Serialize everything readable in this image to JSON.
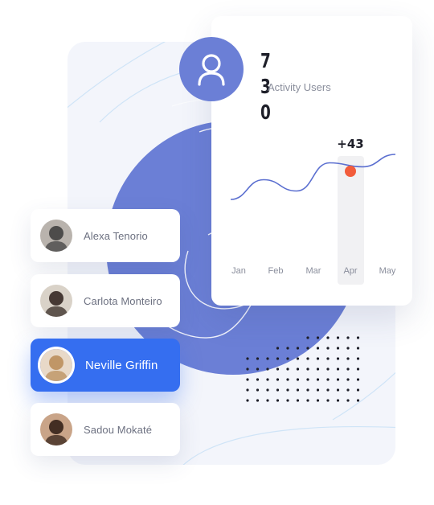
{
  "users": [
    {
      "name": "Alexa Tenorio",
      "active": false
    },
    {
      "name": "Carlota Monteiro",
      "active": false
    },
    {
      "name": "Neville Griffin",
      "active": true
    },
    {
      "name": "Sadou Mokaté",
      "active": false
    }
  ],
  "stats": {
    "value": "730",
    "label": "Activity Users",
    "icon": "user-icon"
  },
  "chart_data": {
    "type": "line",
    "categories": [
      "Jan",
      "Feb",
      "Mar",
      "Apr",
      "May"
    ],
    "series": [
      {
        "values": [
          0.2,
          0.55,
          0.35,
          0.85,
          0.78,
          1.0
        ]
      }
    ],
    "highlight": {
      "category": "Apr",
      "label": "+43"
    },
    "ylim": [
      0,
      1
    ],
    "grid": false
  },
  "colors": {
    "accent": "#356ef0",
    "blob": "#6b7fd6",
    "line": "#5b6fd0",
    "marker": "#f25c3b",
    "panel": "#f3f5fb"
  }
}
